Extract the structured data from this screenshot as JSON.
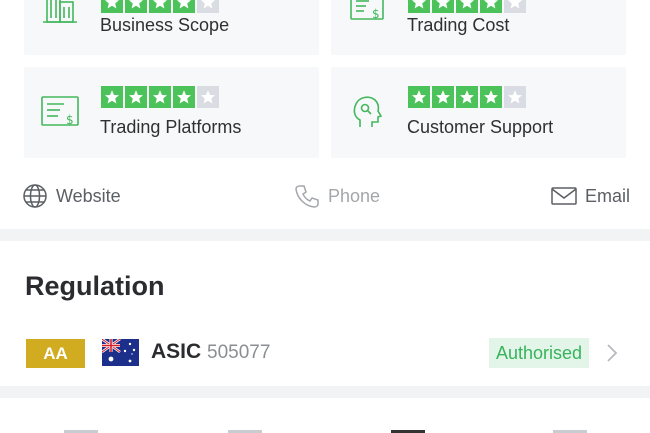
{
  "ratings": [
    {
      "label": "Business Scope",
      "icon": "building-icon",
      "stars": 4
    },
    {
      "label": "Trading Cost",
      "icon": "cost-document-icon",
      "stars": 4
    },
    {
      "label": "Trading Platforms",
      "icon": "platform-document-icon",
      "stars": 4
    },
    {
      "label": "Customer Support",
      "icon": "head-support-icon",
      "stars": 4
    }
  ],
  "contacts": {
    "website": "Website",
    "phone": "Phone",
    "email": "Email"
  },
  "regulation": {
    "title": "Regulation",
    "grade": "AA",
    "country_icon": "australia-flag-icon",
    "regulator": "ASIC",
    "license": "505077",
    "status": "Authorised"
  },
  "colors": {
    "star_on": "#4cc25a",
    "star_off": "#d9dde3",
    "grade_badge": "#d2ac20",
    "status_text": "#37b35b",
    "status_bg": "#e3f5e9"
  },
  "bottom_nav": {
    "items": 4,
    "active_index": 2
  }
}
